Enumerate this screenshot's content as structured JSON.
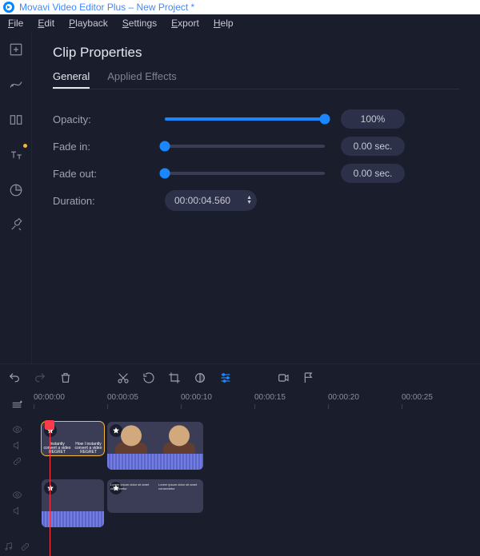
{
  "app": {
    "title": "Movavi Video Editor Plus – New Project *"
  },
  "menu": [
    "File",
    "Edit",
    "Playback",
    "Settings",
    "Export",
    "Help"
  ],
  "props": {
    "title": "Clip Properties",
    "tabs": {
      "general": "General",
      "effects": "Applied Effects"
    },
    "opacity": {
      "label": "Opacity:",
      "value": "100%",
      "pct": 100
    },
    "fade_in": {
      "label": "Fade in:",
      "value": "0.00 sec.",
      "pct": 0
    },
    "fade_out": {
      "label": "Fade out:",
      "value": "0.00 sec.",
      "pct": 0
    },
    "duration": {
      "label": "Duration:",
      "value": "00:00:04.560"
    }
  },
  "timeline": {
    "ruler": [
      "00:00:00",
      "00:00:05",
      "00:00:10",
      "00:00:15",
      "00:00:20",
      "00:00:25"
    ],
    "playhead_time": "00:00:00",
    "track1": {
      "clip1": {
        "title_a": "Instantly convert a video REGRET",
        "title_b": "How I instantly convert a video REGRET"
      },
      "clip2": {
        "wave": true
      }
    },
    "track2": {
      "clip1": {
        "wave": true
      },
      "clip2": {
        "text": "Lorem ipsum dolor sit amet consectetur",
        "text2": "Lorem ipsum dolor sit amet consectetur"
      }
    }
  }
}
